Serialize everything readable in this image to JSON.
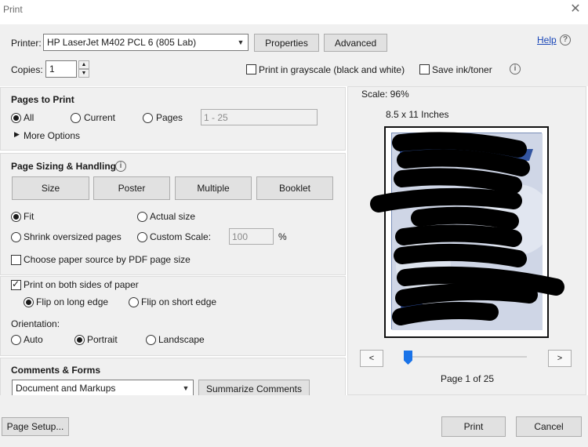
{
  "window": {
    "title": "Print",
    "close_glyph": "✕"
  },
  "top": {
    "printer_label": "Printer:",
    "printer_value": "HP LaserJet M402 PCL 6 (805 Lab)",
    "properties_label": "Properties",
    "advanced_label": "Advanced",
    "help_label": "Help",
    "copies_label": "Copies:",
    "copies_value": "1",
    "grayscale_label": "Print in grayscale (black and white)",
    "grayscale_checked": false,
    "save_ink_label": "Save ink/toner",
    "save_ink_checked": false
  },
  "pages_to_print": {
    "title": "Pages to Print",
    "all_label": "All",
    "current_label": "Current",
    "pages_label": "Pages",
    "pages_range": "1 - 25",
    "selected": "all",
    "more_options_label": "More Options"
  },
  "sizing": {
    "title": "Page Sizing & Handling",
    "tabs": [
      "Size",
      "Poster",
      "Multiple",
      "Booklet"
    ],
    "fit_label": "Fit",
    "actual_size_label": "Actual size",
    "shrink_label": "Shrink oversized pages",
    "custom_scale_label": "Custom Scale:",
    "custom_scale_value": "100",
    "percent": "%",
    "paper_source_label": "Choose paper source by PDF page size",
    "selected": "fit"
  },
  "duplex": {
    "both_sides_label": "Print on both sides of paper",
    "both_sides_checked": true,
    "long_edge_label": "Flip on long edge",
    "short_edge_label": "Flip on short edge",
    "flip": "long",
    "orientation_label": "Orientation:",
    "auto_label": "Auto",
    "portrait_label": "Portrait",
    "landscape_label": "Landscape",
    "orientation": "portrait"
  },
  "comments": {
    "title": "Comments & Forms",
    "selected_value": "Document and Markups",
    "summarize_label": "Summarize Comments"
  },
  "preview": {
    "scale_text": "Scale:  96%",
    "paper_size": "8.5 x 11 Inches",
    "prev_label": "<",
    "next_label": ">",
    "page_status": "Page 1 of 25",
    "slider_position": 0.0
  },
  "footer": {
    "page_setup_label": "Page Setup...",
    "print_label": "Print",
    "cancel_label": "Cancel"
  },
  "colors": {
    "panel_bg": "#f0f0f0",
    "link": "#1a47b8",
    "redaction": "#000000",
    "page_tint": "#cfd6e6"
  }
}
